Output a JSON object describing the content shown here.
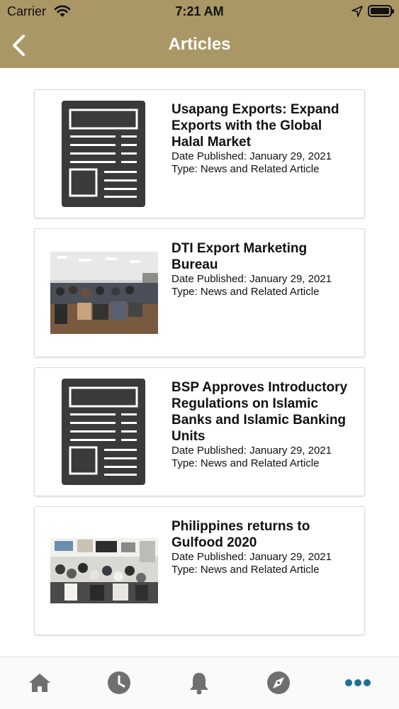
{
  "status_bar": {
    "carrier": "Carrier",
    "time": "7:21 AM"
  },
  "nav": {
    "title": "Articles",
    "back_icon": "chevron-left-icon"
  },
  "colors": {
    "header": "#a99766",
    "tab_icon": "#6f6f6f",
    "tab_active": "#1f6f93"
  },
  "articles": [
    {
      "title": "Usapang Exports: Expand Exports with the Global Halal Market",
      "date": "Date Published: January 29, 2021",
      "type": "Type: News and Related Article",
      "thumbnail": "newspaper-icon"
    },
    {
      "title": "DTI Export Marketing Bureau",
      "date": "Date Published: January 29, 2021",
      "type": "Type: News and Related Article",
      "thumbnail": "photo-seminar-room"
    },
    {
      "title": "BSP Approves Introductory Regulations on Islamic Banks and Islamic Banking Units",
      "date": "Date Published: January 29, 2021",
      "type": "Type: News and Related Article",
      "thumbnail": "newspaper-icon"
    },
    {
      "title": "Philippines returns to Gulfood 2020",
      "date": "Date Published: January 29, 2021",
      "type": "Type: News and Related Article",
      "thumbnail": "photo-expo-crowd"
    }
  ],
  "tab_bar": {
    "tabs": [
      {
        "icon": "home-icon",
        "active": false
      },
      {
        "icon": "clock-icon",
        "active": false
      },
      {
        "icon": "bell-icon",
        "active": false
      },
      {
        "icon": "compass-icon",
        "active": false
      },
      {
        "icon": "more-icon",
        "active": true
      }
    ]
  }
}
